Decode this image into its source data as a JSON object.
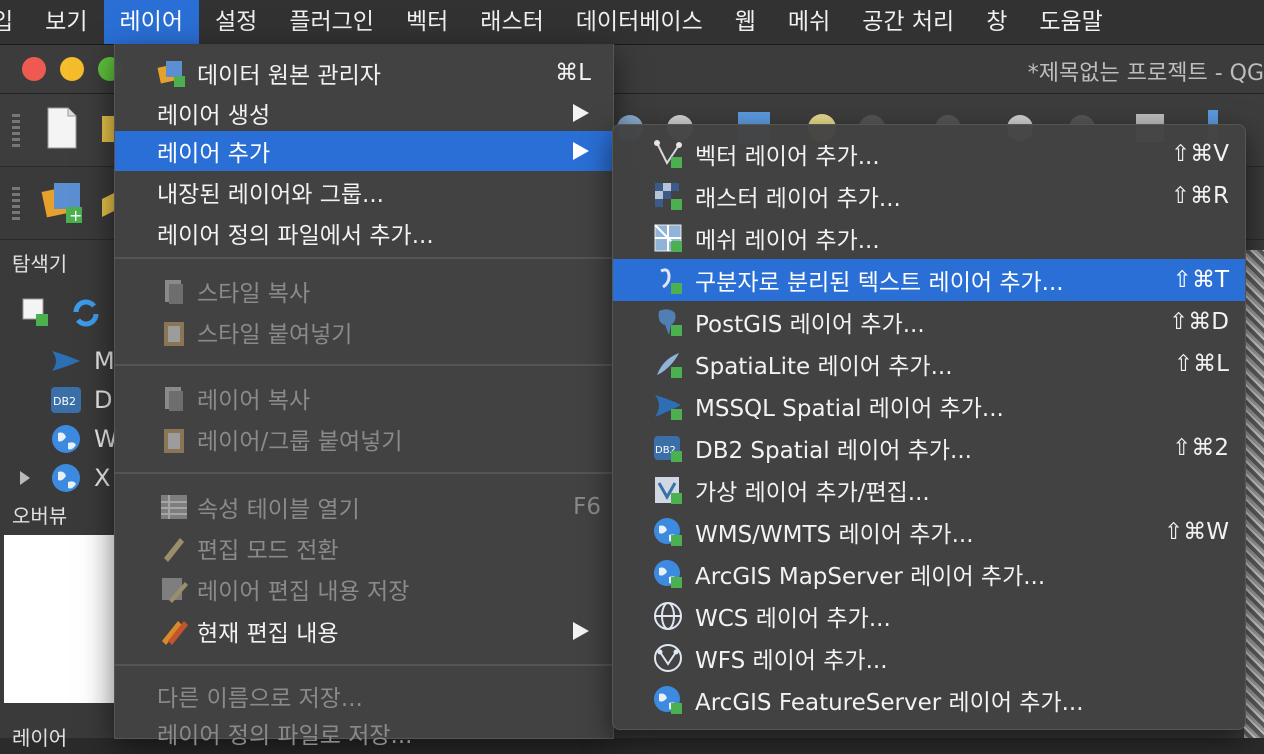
{
  "menubar": {
    "items": [
      "입",
      "보기",
      "레이어",
      "설정",
      "플러그인",
      "벡터",
      "래스터",
      "데이터베이스",
      "웹",
      "메쉬",
      "공간 처리",
      "창",
      "도움말"
    ],
    "active_index": 2
  },
  "window": {
    "title": "*제목없는 프로젝트 - QG"
  },
  "left_panel": {
    "browser_title": "탐색기",
    "tree": [
      {
        "label": "M",
        "icon": "mssql-icon"
      },
      {
        "label": "D",
        "icon": "db2-icon"
      },
      {
        "label": "W",
        "icon": "globe-icon"
      },
      {
        "label": "X",
        "icon": "globe-icon"
      }
    ],
    "overview_title": "오버뷰",
    "layers_title": "레이어"
  },
  "layer_menu": {
    "items": [
      {
        "label": "데이터 원본 관리자",
        "shortcut": "⌘L",
        "icon": "data-source-manager-icon"
      },
      {
        "label": "레이어 생성",
        "submenu": true
      },
      {
        "label": "레이어 추가",
        "submenu": true,
        "highlight": true
      },
      {
        "label": "내장된 레이어와 그룹..."
      },
      {
        "label": "레이어 정의 파일에서 추가..."
      },
      {
        "label": "스타일 복사",
        "disabled": true,
        "icon": "copy-icon"
      },
      {
        "label": "스타일 붙여넣기",
        "disabled": true,
        "icon": "paste-icon"
      },
      {
        "label": "레이어 복사",
        "disabled": true,
        "icon": "copy-icon"
      },
      {
        "label": "레이어/그룹 붙여넣기",
        "disabled": true,
        "icon": "paste-icon"
      },
      {
        "label": "속성 테이블 열기",
        "disabled": true,
        "shortcut": "F6",
        "icon": "table-icon"
      },
      {
        "label": "편집 모드 전환",
        "disabled": true,
        "icon": "pencil-icon"
      },
      {
        "label": "레이어 편집 내용 저장",
        "disabled": true,
        "icon": "save-edits-icon"
      },
      {
        "label": "현재 편집 내용",
        "submenu": true,
        "icon": "current-edits-icon"
      },
      {
        "label": "다른 이름으로 저장...",
        "disabled": true
      },
      {
        "label": "레이어 정의 파일로 저장...",
        "disabled": true
      }
    ]
  },
  "add_layer_menu": {
    "items": [
      {
        "label": "벡터 레이어 추가...",
        "shortcut": "⇧⌘V",
        "icon": "vector-layer-icon"
      },
      {
        "label": "래스터 레이어 추가...",
        "shortcut": "⇧⌘R",
        "icon": "raster-layer-icon"
      },
      {
        "label": "메쉬 레이어 추가...",
        "icon": "mesh-layer-icon"
      },
      {
        "label": "구분자로 분리된 텍스트 레이어 추가...",
        "shortcut": "⇧⌘T",
        "icon": "delimited-text-icon",
        "highlight": true
      },
      {
        "label": "PostGIS 레이어 추가...",
        "shortcut": "⇧⌘D",
        "icon": "postgis-icon"
      },
      {
        "label": "SpatiaLite 레이어 추가...",
        "shortcut": "⇧⌘L",
        "icon": "spatialite-icon"
      },
      {
        "label": "MSSQL Spatial 레이어 추가...",
        "icon": "mssql-icon"
      },
      {
        "label": "DB2 Spatial 레이어 추가...",
        "shortcut": "⇧⌘2",
        "icon": "db2-icon"
      },
      {
        "label": "가상 레이어 추가/편집...",
        "icon": "virtual-layer-icon"
      },
      {
        "label": "WMS/WMTS 레이어 추가...",
        "shortcut": "⇧⌘W",
        "icon": "wms-icon"
      },
      {
        "label": "ArcGIS MapServer 레이어 추가...",
        "icon": "arcgis-mapserver-icon"
      },
      {
        "label": "WCS 레이어 추가...",
        "icon": "wcs-icon"
      },
      {
        "label": "WFS 레이어 추가...",
        "icon": "wfs-icon"
      },
      {
        "label": "ArcGIS FeatureServer 레이어 추가...",
        "icon": "arcgis-featureserver-icon"
      }
    ]
  },
  "colors": {
    "highlight": "#2a6fd6",
    "menu_bg": "#424242",
    "disabled_text": "#8a8a8a"
  }
}
